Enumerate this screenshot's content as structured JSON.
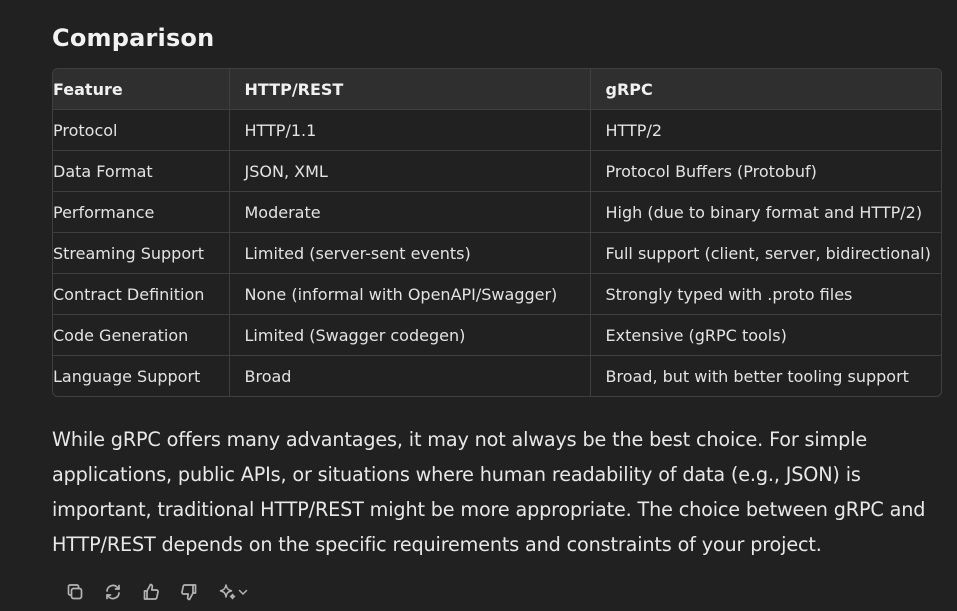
{
  "heading": "Comparison",
  "table": {
    "headers": [
      "Feature",
      "HTTP/REST",
      "gRPC"
    ],
    "rows": [
      [
        "Protocol",
        "HTTP/1.1",
        "HTTP/2"
      ],
      [
        "Data Format",
        "JSON, XML",
        "Protocol Buffers (Protobuf)"
      ],
      [
        "Performance",
        "Moderate",
        "High (due to binary format and HTTP/2)"
      ],
      [
        "Streaming Support",
        "Limited (server-sent events)",
        "Full support (client, server, bidirectional)"
      ],
      [
        "Contract Definition",
        "None (informal with OpenAPI/Swagger)",
        "Strongly typed with .proto files"
      ],
      [
        "Code Generation",
        "Limited (Swagger codegen)",
        "Extensive (gRPC tools)"
      ],
      [
        "Language Support",
        "Broad",
        "Broad, but with better tooling support"
      ]
    ]
  },
  "paragraph": "While gRPC offers many advantages, it may not always be the best choice. For simple applications, public APIs, or situations where human readability of data (e.g., JSON) is important, traditional HTTP/REST might be more appropriate. The choice between gRPC and HTTP/REST depends on the specific requirements and constraints of your project.",
  "actions": {
    "icons": [
      "copy-icon",
      "regenerate-icon",
      "thumbs-up-icon",
      "thumbs-down-icon",
      "sparkle-icon",
      "chevron-down-icon"
    ]
  },
  "colors": {
    "background": "#212121",
    "header_row": "#2f2f2f",
    "border": "#3f3f3f",
    "text": "#ececec",
    "icon": "#b4b4b4"
  }
}
